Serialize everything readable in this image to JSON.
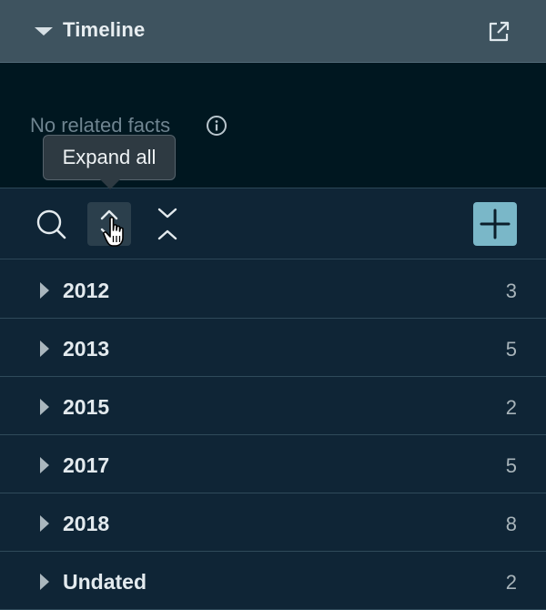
{
  "header": {
    "title": "Timeline",
    "collapse_icon": "caret-down-icon",
    "popout_icon": "external-link-icon"
  },
  "facts": {
    "message": "No related facts",
    "info_icon": "info-icon"
  },
  "tooltip": {
    "text": "Expand all"
  },
  "toolbar": {
    "search_icon": "search-icon",
    "expand_icon": "expand-all-icon",
    "collapse_icon": "collapse-all-icon",
    "add_icon": "plus-icon"
  },
  "colors": {
    "accent": "#7ab7c8",
    "header_bg": "#3e535f",
    "panel_bg": "#0f2536",
    "facts_bg": "#001720"
  },
  "groups": [
    {
      "label": "2012",
      "count": "3"
    },
    {
      "label": "2013",
      "count": "5"
    },
    {
      "label": "2015",
      "count": "2"
    },
    {
      "label": "2017",
      "count": "5"
    },
    {
      "label": "2018",
      "count": "8"
    },
    {
      "label": "Undated",
      "count": "2"
    }
  ]
}
